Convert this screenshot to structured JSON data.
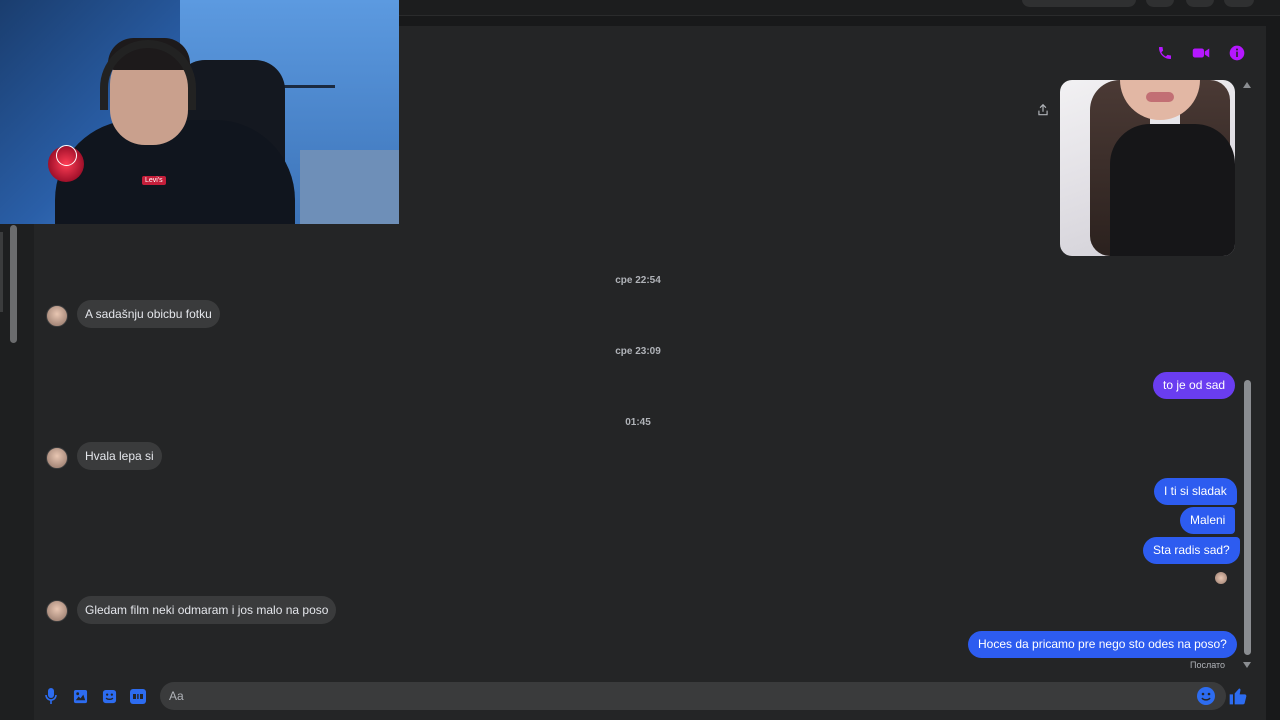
{
  "colors": {
    "accent_purple": "#b517ff",
    "accent_blue": "#2d6cf0",
    "bubble_out_purple": "#6a3df0",
    "bubble_out_blue": "#2d5cf0",
    "bubble_in": "#3a3b3c"
  },
  "header": {
    "actions": [
      {
        "icon": "phone-icon"
      },
      {
        "icon": "video-camera-icon"
      },
      {
        "icon": "info-icon"
      }
    ]
  },
  "webcam": {
    "logo_text": "Levi's"
  },
  "conversation": {
    "timestamps": [
      "сре 22:54",
      "сре 23:09",
      "01:45"
    ],
    "incoming": [
      "A sadašnju obicbu fotku",
      "Hvala lepa si",
      "Gledam film neki odmaram i jos malo na poso"
    ],
    "outgoing": [
      "to je od sad",
      "I ti si sladak",
      "Maleni",
      "Sta radis sad?",
      "Hoces da pricamo pre nego sto odes na poso?"
    ],
    "sent_status": "Послато"
  },
  "composer": {
    "placeholder": "Aa",
    "icons": [
      "microphone-icon",
      "image-icon",
      "sticker-icon",
      "gif-icon",
      "emoji-icon",
      "like-icon"
    ]
  }
}
